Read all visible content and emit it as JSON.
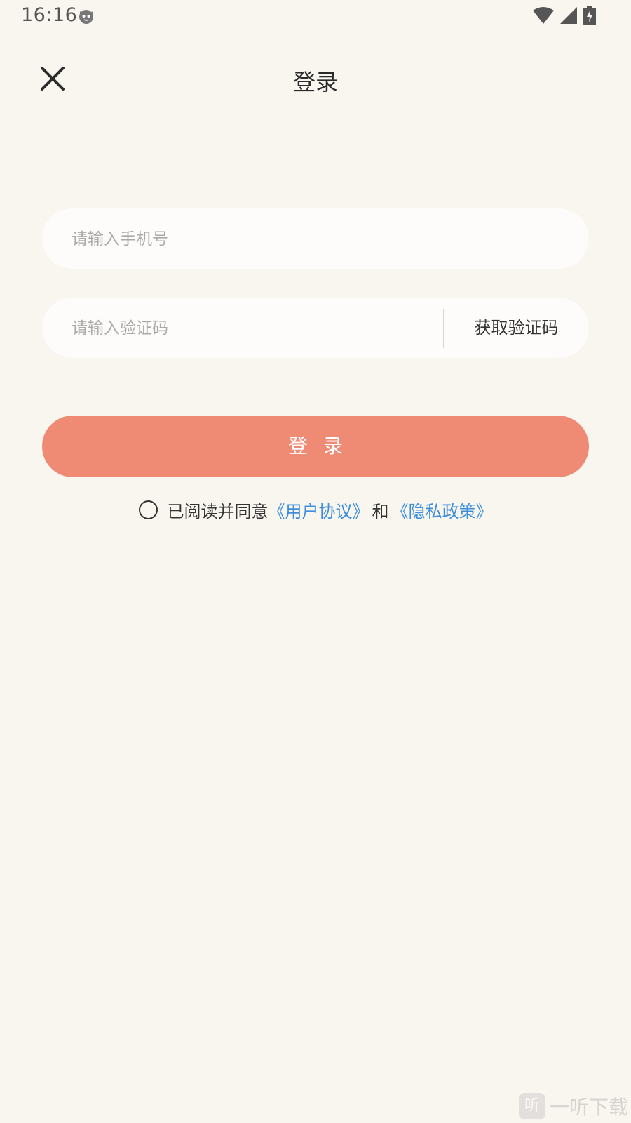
{
  "status_bar": {
    "time": "16:16",
    "icons": [
      "cat-face-icon",
      "wifi-icon",
      "cellular-signal-icon",
      "battery-charging-icon"
    ]
  },
  "header": {
    "title": "登录",
    "close_icon": "close-icon"
  },
  "form": {
    "phone_placeholder": "请输入手机号",
    "code_placeholder": "请输入验证码",
    "get_code_label": "获取验证码",
    "login_label": "登录"
  },
  "agreement": {
    "text": "已阅读并同意",
    "user_agreement": "《用户协议》",
    "and": "和",
    "privacy_policy": "《隐私政策》",
    "checked": false
  },
  "watermark": {
    "logo_text": "听",
    "text": "一听下载"
  },
  "colors": {
    "background": "#f9f5ef",
    "accent": "#ef8b74",
    "link": "#3d8fd9"
  }
}
